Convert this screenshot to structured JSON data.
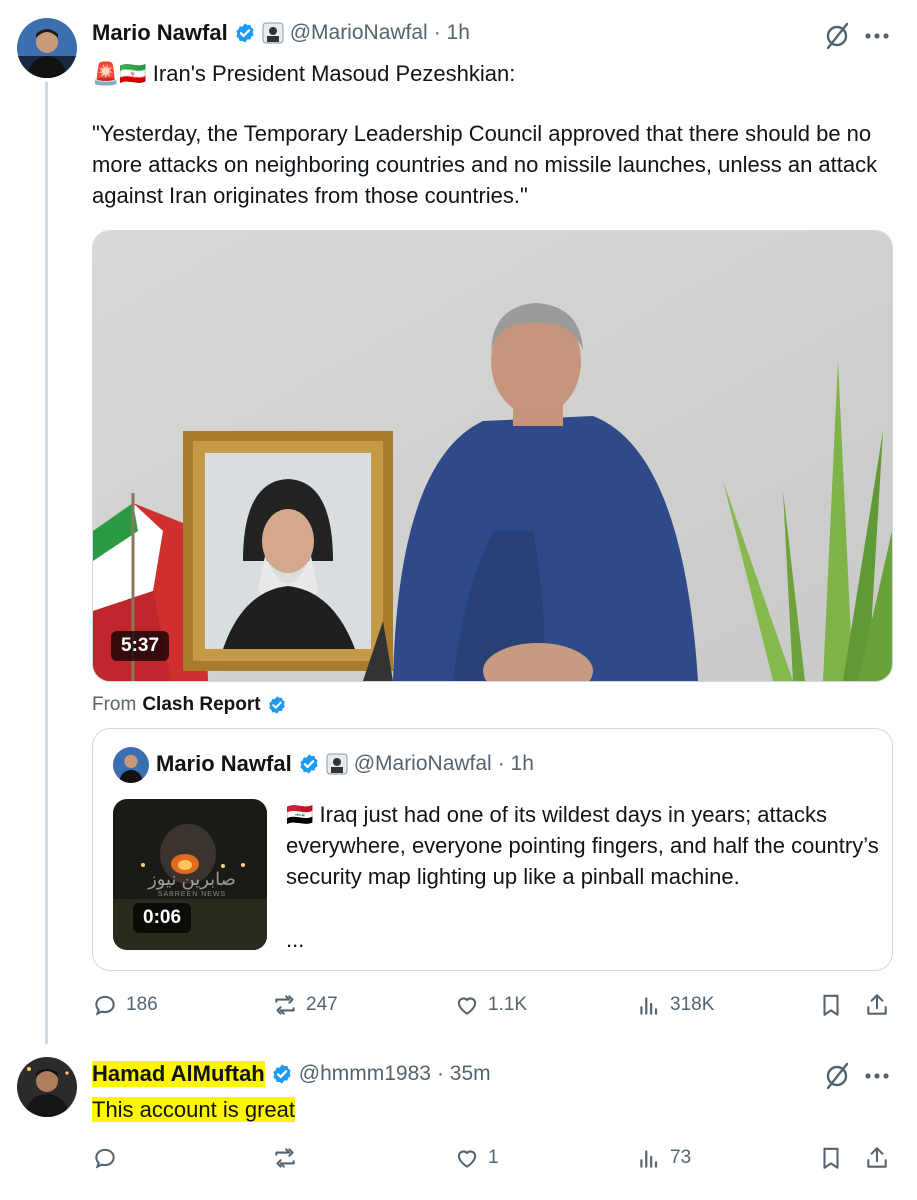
{
  "tweet": {
    "author_name": "Mario Nawfal",
    "handle": "@MarioNawfal",
    "time": "· 1h",
    "flags": "🚨🇮🇷",
    "headline": "Iran's President Masoud Pezeshkian:",
    "quote_text": "\"Yesterday, the Temporary Leadership Council approved that there should be no more attacks on neighboring countries and no missile launches, unless an attack against Iran originates from those countries.\"",
    "video_duration": "5:37",
    "from_label": "From",
    "from_source": "Clash Report",
    "menu_icon": "more-icon",
    "grok_icon": "grok-icon"
  },
  "quoted": {
    "author_name": "Mario Nawfal",
    "handle": "@MarioNawfal",
    "time": "· 1h",
    "flag": "🇮🇶",
    "text": "Iraq just had one of its wildest days in years; attacks everywhere, everyone pointing fingers, and half the country’s security map lighting up like a pinball machine.",
    "ellipsis": "...",
    "video_duration": "0:06",
    "watermark": "صابرين نيوز",
    "watermark_sub": "SABREEN NEWS"
  },
  "actions": {
    "replies": "186",
    "reposts": "247",
    "likes": "1.1K",
    "views": "318K"
  },
  "reply": {
    "author_name": "Hamad AlMuftah",
    "handle": "@hmmm1983",
    "time": "· 35m",
    "text": "This account is great",
    "replies": "",
    "reposts": "",
    "likes": "1",
    "views": "73"
  },
  "colors": {
    "verified": "#1d9bf0",
    "secondary_text": "#536471",
    "highlight": "#fff700"
  }
}
